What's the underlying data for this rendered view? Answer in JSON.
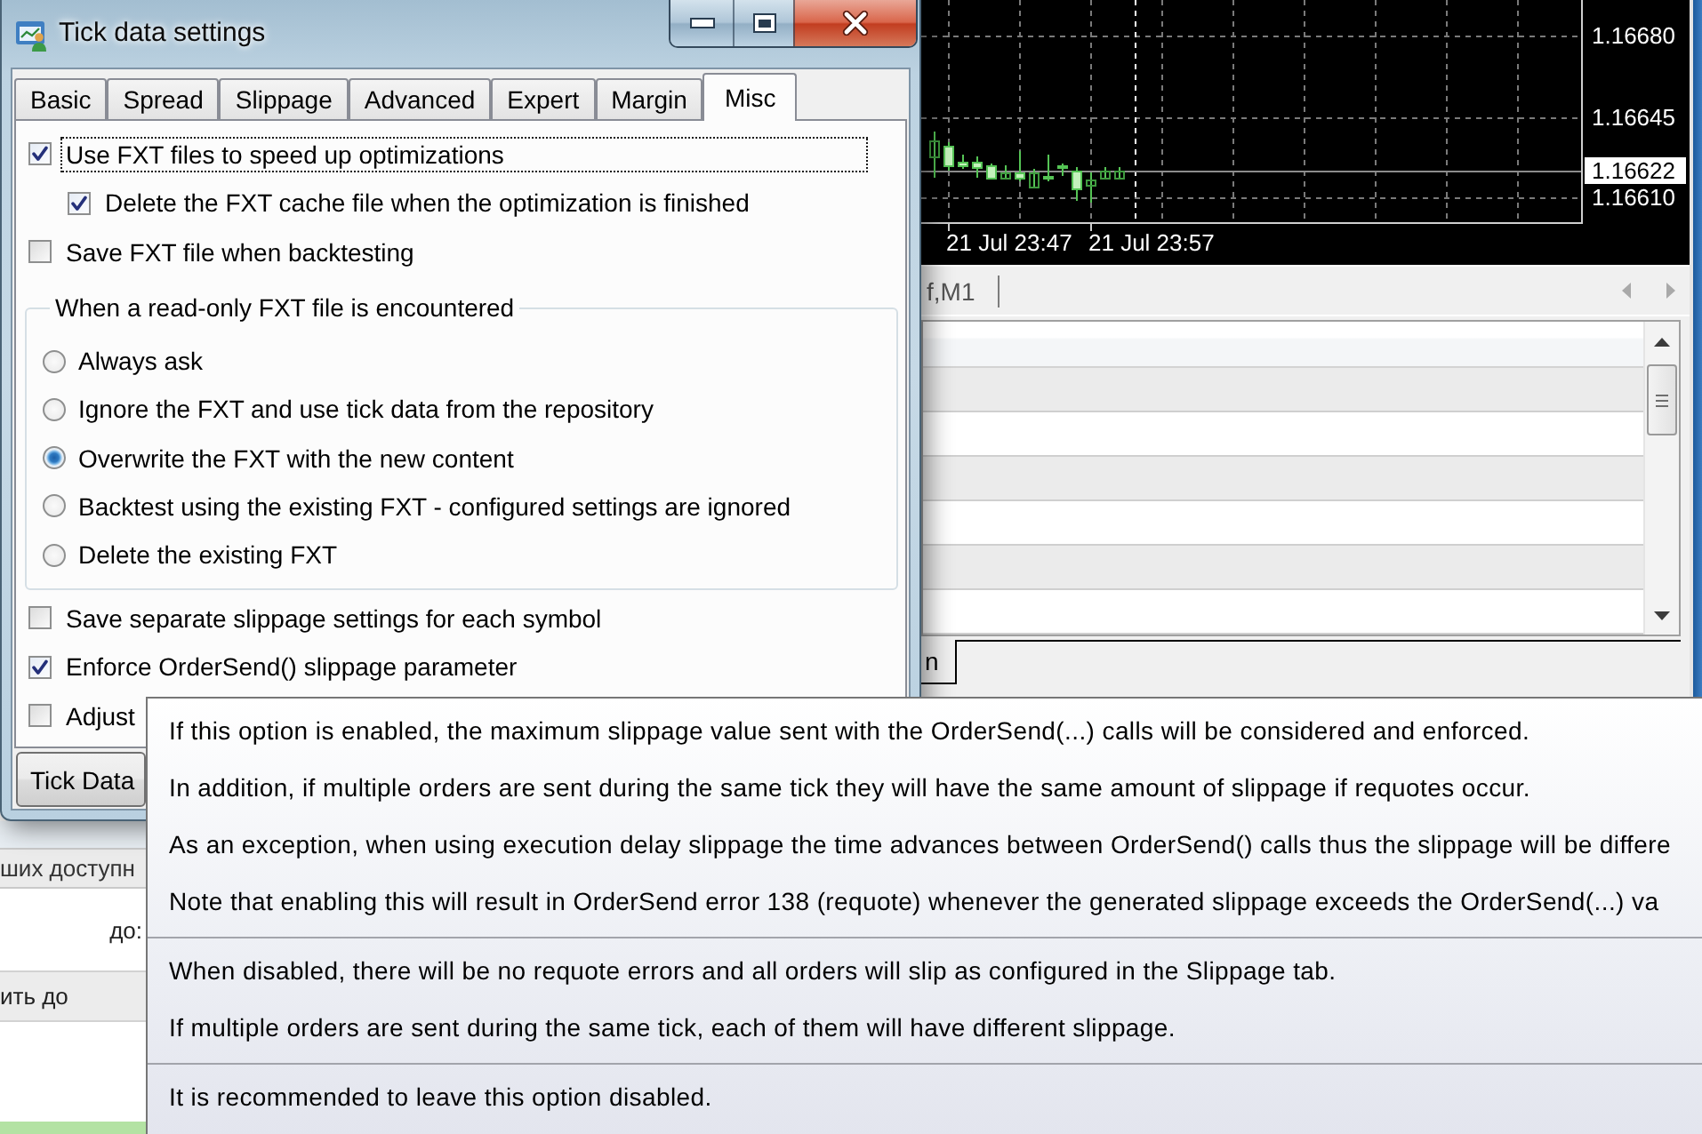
{
  "dialog": {
    "title": "Tick data settings",
    "tabs": [
      {
        "label": "Basic",
        "selected": false
      },
      {
        "label": "Spread",
        "selected": false
      },
      {
        "label": "Slippage",
        "selected": false
      },
      {
        "label": "Advanced",
        "selected": false
      },
      {
        "label": "Expert",
        "selected": false
      },
      {
        "label": "Margin",
        "selected": false
      },
      {
        "label": "Misc",
        "selected": true
      }
    ],
    "options": [
      {
        "label": "Use FXT files to speed up optimizations",
        "checked": true,
        "focused": true,
        "children": [
          {
            "label": "Delete the FXT cache file when the optimization is finished",
            "checked": true,
            "focused": false
          }
        ]
      },
      {
        "label": "Save FXT file when backtesting",
        "checked": false,
        "focused": false
      }
    ],
    "read_only_group": {
      "title": "When a read-only FXT file is encountered",
      "choices": [
        {
          "label": "Always ask",
          "selected": false
        },
        {
          "label": "Ignore the FXT and use tick data from the repository",
          "selected": false
        },
        {
          "label": "Overwrite the FXT with the new content",
          "selected": true
        },
        {
          "label": "Backtest using the existing FXT - configured settings are ignored",
          "selected": false
        },
        {
          "label": "Delete the existing FXT",
          "selected": false
        }
      ]
    },
    "slippage_options": [
      {
        "label": "Save separate slippage settings for each symbol",
        "checked": false,
        "focused": false
      },
      {
        "label": "Enforce OrderSend() slippage parameter",
        "checked": true,
        "focused": false
      },
      {
        "label": "Adjust",
        "checked": false,
        "focused": false
      }
    ],
    "buttons": [
      "Tick Data"
    ]
  },
  "chart": {
    "price_labels": [
      {
        "text": "1.16680",
        "current": false
      },
      {
        "text": "1.16645",
        "current": false
      },
      {
        "text": "1.16622",
        "current": true
      },
      {
        "text": "1.16610",
        "current": false
      }
    ],
    "time_labels": [
      "21 Jul 23:47",
      "21 Jul 23:57"
    ]
  },
  "chart_tabs": [
    "f,M1"
  ],
  "bottom_tabs": [
    {
      "label": "n",
      "selected": true
    }
  ],
  "lower_list": {
    "header": "ших доступн",
    "rows": [
      "до:",
      "ить до"
    ]
  },
  "tooltip": {
    "sections": [
      {
        "lines": [
          "If this option is enabled, the maximum slippage value sent with the OrderSend(...) calls will be considered and enforced.",
          "In addition, if multiple orders are sent during the same tick they will have the same amount of slippage if requotes occur.",
          "As an exception, when using execution delay slippage the time advances between OrderSend() calls thus the slippage will be differe",
          "Note that enabling this will result in OrderSend error 138 (requote) whenever the generated slippage exceeds the OrderSend(...) va"
        ]
      },
      {
        "lines": [
          "When disabled, there will be no requote errors and all orders will slip as configured in the Slippage tab.",
          "If multiple orders are sent during the same tick, each of them will have different slippage."
        ]
      },
      {
        "lines": [
          "It is recommended to leave this option disabled."
        ]
      }
    ]
  }
}
